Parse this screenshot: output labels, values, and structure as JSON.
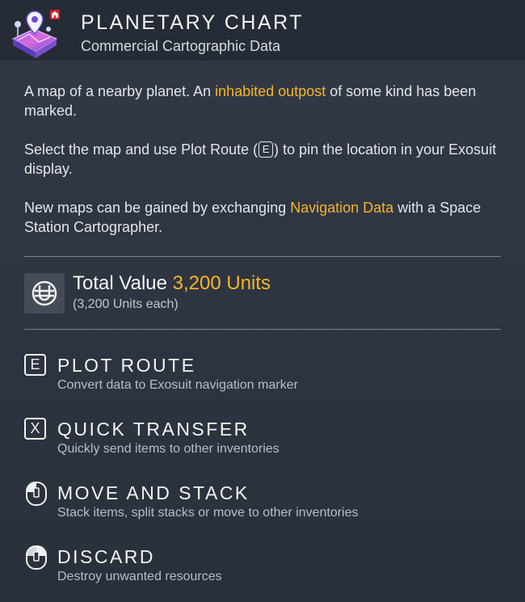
{
  "item": {
    "title": "PLANETARY CHART",
    "subtitle": "Commercial Cartographic Data"
  },
  "description": {
    "p1_a": "A map of a nearby planet. An ",
    "p1_highlight": "inhabited outpost",
    "p1_b": " of some kind has been marked.",
    "p2_a": "Select the map and use Plot Route (",
    "p2_key": "E",
    "p2_b": ") to pin the location in your Exosuit display.",
    "p3_a": "New maps can be gained by exchanging ",
    "p3_highlight": "Navigation Data",
    "p3_b": " with a Space Station Cartographer."
  },
  "value": {
    "label": "Total Value",
    "amount": "3,200 Units",
    "each": "(3,200 Units each)",
    "currency_icon": "units-icon"
  },
  "actions": [
    {
      "key": "E",
      "icon": "key-e-icon",
      "title": "PLOT ROUTE",
      "desc": "Convert data to Exosuit navigation marker"
    },
    {
      "key": "X",
      "icon": "key-x-icon",
      "title": "QUICK TRANSFER",
      "desc": "Quickly send items to other inventories"
    },
    {
      "key": "",
      "icon": "mouse-left-icon",
      "title": "MOVE AND STACK",
      "desc": "Stack items, split stacks or move to other inventories"
    },
    {
      "key": "",
      "icon": "mouse-right-icon",
      "title": "DISCARD",
      "desc": "Destroy unwanted resources"
    }
  ],
  "colors": {
    "highlight": "#f6b52c",
    "text": "#e3e6ea",
    "background": "#2d343f"
  }
}
